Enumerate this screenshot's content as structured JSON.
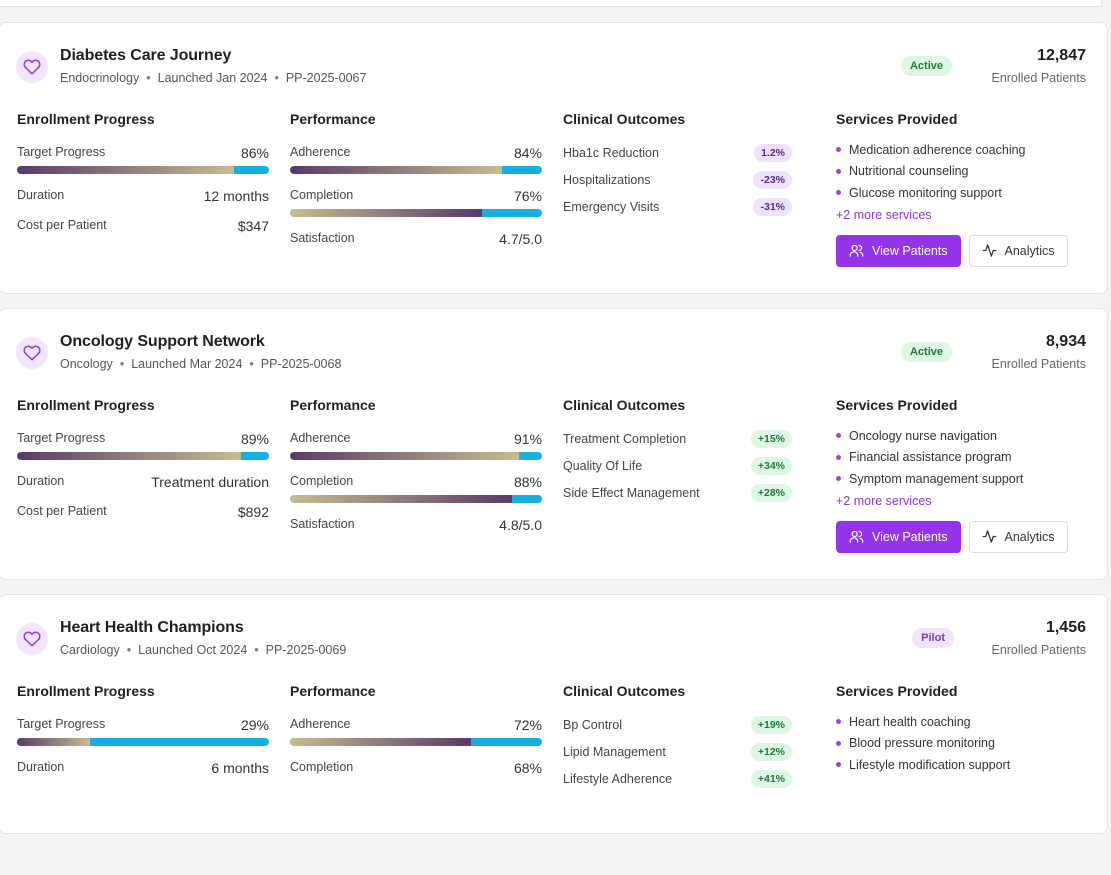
{
  "labels": {
    "enrolled": "Enrolled Patients",
    "enrollment_progress": "Enrollment Progress",
    "performance": "Performance",
    "clinical_outcomes": "Clinical Outcomes",
    "services_provided": "Services Provided",
    "target_progress": "Target Progress",
    "duration": "Duration",
    "cost_per_patient": "Cost per Patient",
    "adherence": "Adherence",
    "completion": "Completion",
    "satisfaction": "Satisfaction",
    "view_patients": "View Patients",
    "analytics": "Analytics"
  },
  "colors": {
    "accent": "#9333ea",
    "bar_blue": "#15b0e0",
    "bar_gradient_dark": "#5a3a6a",
    "bar_gradient_light": "#c8bc8e"
  },
  "programs": [
    {
      "title": "Diabetes Care Journey",
      "specialty": "Endocrinology",
      "launched": "Launched Jan 2024",
      "code": "PP-2025-0067",
      "status": "Active",
      "enrolled": "12,847",
      "target_progress": "86%",
      "target_progress_value": 0.86,
      "duration": "12 months",
      "cost": "$347",
      "adherence": "84%",
      "adherence_value": 0.84,
      "completion": "76%",
      "completion_value": 0.76,
      "satisfaction": "4.7/5.0",
      "outcomes": [
        {
          "name": "Hba1c Reduction",
          "value": "1.2%",
          "tone": "purple"
        },
        {
          "name": "Hospitalizations",
          "value": "-23%",
          "tone": "purple"
        },
        {
          "name": "Emergency Visits",
          "value": "-31%",
          "tone": "purple"
        }
      ],
      "services": [
        "Medication adherence coaching",
        "Nutritional counseling",
        "Glucose monitoring support"
      ],
      "more_services": "+2 more services"
    },
    {
      "title": "Oncology Support Network",
      "specialty": "Oncology",
      "launched": "Launched Mar 2024",
      "code": "PP-2025-0068",
      "status": "Active",
      "enrolled": "8,934",
      "target_progress": "89%",
      "target_progress_value": 0.89,
      "duration": "Treatment duration",
      "cost": "$892",
      "adherence": "91%",
      "adherence_value": 0.91,
      "completion": "88%",
      "completion_value": 0.88,
      "satisfaction": "4.8/5.0",
      "outcomes": [
        {
          "name": "Treatment Completion",
          "value": "+15%",
          "tone": "green"
        },
        {
          "name": "Quality Of Life",
          "value": "+34%",
          "tone": "green"
        },
        {
          "name": "Side Effect Management",
          "value": "+28%",
          "tone": "green"
        }
      ],
      "services": [
        "Oncology nurse navigation",
        "Financial assistance program",
        "Symptom management support"
      ],
      "more_services": "+2 more services"
    },
    {
      "title": "Heart Health Champions",
      "specialty": "Cardiology",
      "launched": "Launched Oct 2024",
      "code": "PP-2025-0069",
      "status": "Pilot",
      "enrolled": "1,456",
      "target_progress": "29%",
      "target_progress_value": 0.29,
      "duration": "6 months",
      "cost": "",
      "adherence": "72%",
      "adherence_value": 0.72,
      "completion": "68%",
      "completion_value": 0.68,
      "satisfaction": "",
      "outcomes": [
        {
          "name": "Bp Control",
          "value": "+19%",
          "tone": "green"
        },
        {
          "name": "Lipid Management",
          "value": "+12%",
          "tone": "green"
        },
        {
          "name": "Lifestyle Adherence",
          "value": "+41%",
          "tone": "green"
        }
      ],
      "services": [
        "Heart health coaching",
        "Blood pressure monitoring",
        "Lifestyle modification support"
      ],
      "more_services": ""
    }
  ]
}
